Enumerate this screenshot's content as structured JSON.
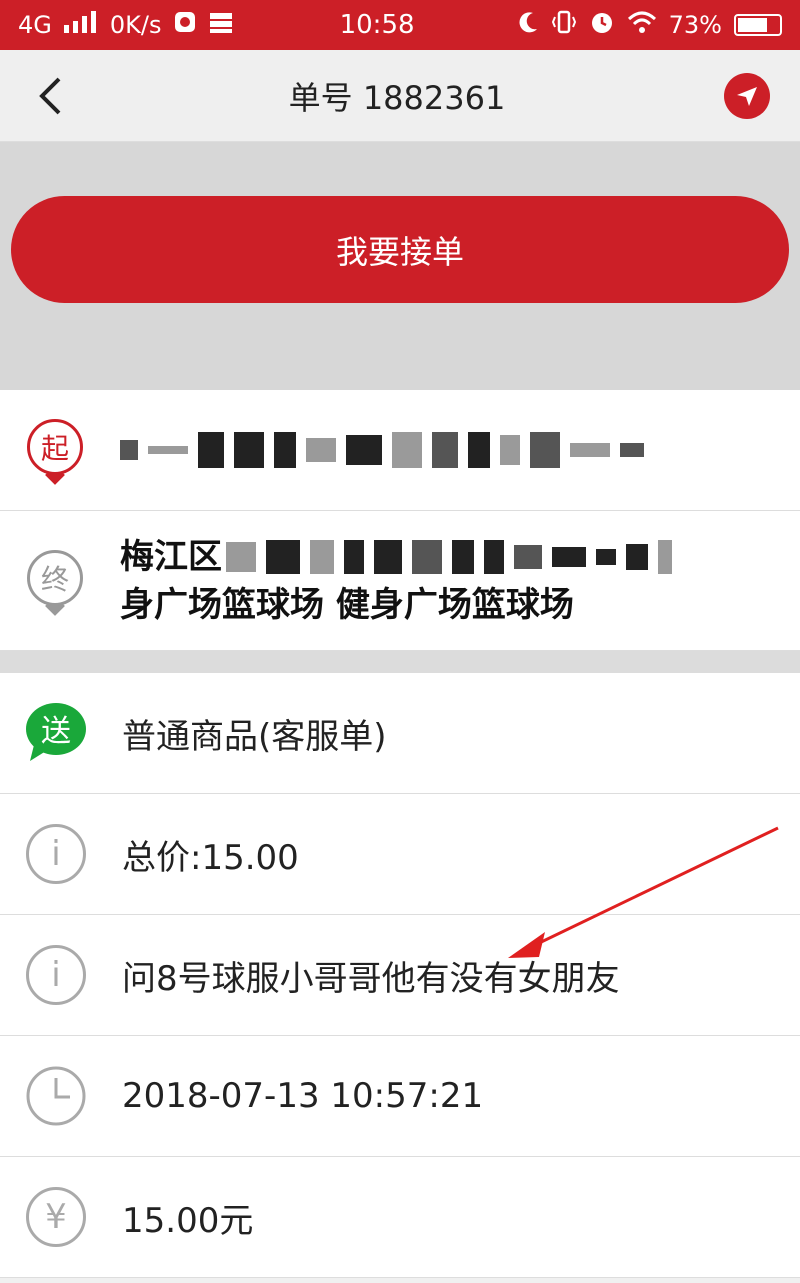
{
  "status_bar": {
    "network": "4G",
    "speed": "0K/s",
    "time": "10:58",
    "battery": "73%",
    "battery_level": 0.73
  },
  "nav": {
    "title": "单号 1882361"
  },
  "accept_button": {
    "label": "我要接单"
  },
  "route": {
    "start_badge": "起",
    "end_badge": "终",
    "end_line1_prefix": "梅江区",
    "end_line2": "身广场篮球场 健身广场篮球场"
  },
  "details": {
    "type_badge": "送",
    "type_text": "普通商品(客服单)",
    "total_price": "总价:15.00",
    "note": "问8号球服小哥哥他有没有女朋友",
    "time": "2018-07-13 10:57:21",
    "amount": "15.00元"
  },
  "colors": {
    "brand_red": "#cc1f27",
    "green": "#1aa83a"
  }
}
